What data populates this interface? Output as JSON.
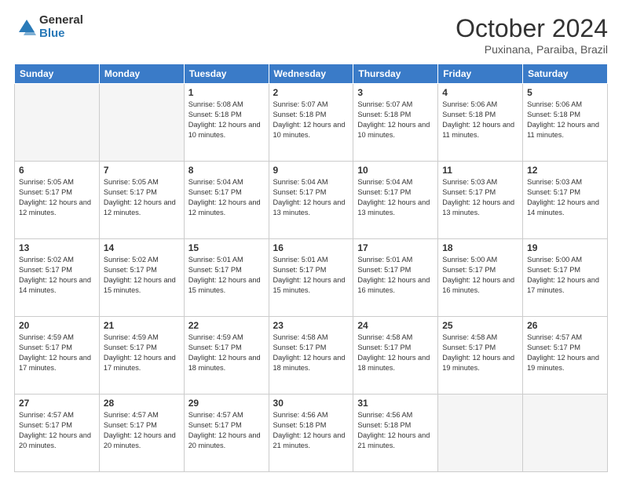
{
  "header": {
    "logo_general": "General",
    "logo_blue": "Blue",
    "month_title": "October 2024",
    "subtitle": "Puxinana, Paraiba, Brazil"
  },
  "weekdays": [
    "Sunday",
    "Monday",
    "Tuesday",
    "Wednesday",
    "Thursday",
    "Friday",
    "Saturday"
  ],
  "weeks": [
    [
      {
        "day": "",
        "info": ""
      },
      {
        "day": "",
        "info": ""
      },
      {
        "day": "1",
        "info": "Sunrise: 5:08 AM\nSunset: 5:18 PM\nDaylight: 12 hours and 10 minutes."
      },
      {
        "day": "2",
        "info": "Sunrise: 5:07 AM\nSunset: 5:18 PM\nDaylight: 12 hours and 10 minutes."
      },
      {
        "day": "3",
        "info": "Sunrise: 5:07 AM\nSunset: 5:18 PM\nDaylight: 12 hours and 10 minutes."
      },
      {
        "day": "4",
        "info": "Sunrise: 5:06 AM\nSunset: 5:18 PM\nDaylight: 12 hours and 11 minutes."
      },
      {
        "day": "5",
        "info": "Sunrise: 5:06 AM\nSunset: 5:18 PM\nDaylight: 12 hours and 11 minutes."
      }
    ],
    [
      {
        "day": "6",
        "info": "Sunrise: 5:05 AM\nSunset: 5:17 PM\nDaylight: 12 hours and 12 minutes."
      },
      {
        "day": "7",
        "info": "Sunrise: 5:05 AM\nSunset: 5:17 PM\nDaylight: 12 hours and 12 minutes."
      },
      {
        "day": "8",
        "info": "Sunrise: 5:04 AM\nSunset: 5:17 PM\nDaylight: 12 hours and 12 minutes."
      },
      {
        "day": "9",
        "info": "Sunrise: 5:04 AM\nSunset: 5:17 PM\nDaylight: 12 hours and 13 minutes."
      },
      {
        "day": "10",
        "info": "Sunrise: 5:04 AM\nSunset: 5:17 PM\nDaylight: 12 hours and 13 minutes."
      },
      {
        "day": "11",
        "info": "Sunrise: 5:03 AM\nSunset: 5:17 PM\nDaylight: 12 hours and 13 minutes."
      },
      {
        "day": "12",
        "info": "Sunrise: 5:03 AM\nSunset: 5:17 PM\nDaylight: 12 hours and 14 minutes."
      }
    ],
    [
      {
        "day": "13",
        "info": "Sunrise: 5:02 AM\nSunset: 5:17 PM\nDaylight: 12 hours and 14 minutes."
      },
      {
        "day": "14",
        "info": "Sunrise: 5:02 AM\nSunset: 5:17 PM\nDaylight: 12 hours and 15 minutes."
      },
      {
        "day": "15",
        "info": "Sunrise: 5:01 AM\nSunset: 5:17 PM\nDaylight: 12 hours and 15 minutes."
      },
      {
        "day": "16",
        "info": "Sunrise: 5:01 AM\nSunset: 5:17 PM\nDaylight: 12 hours and 15 minutes."
      },
      {
        "day": "17",
        "info": "Sunrise: 5:01 AM\nSunset: 5:17 PM\nDaylight: 12 hours and 16 minutes."
      },
      {
        "day": "18",
        "info": "Sunrise: 5:00 AM\nSunset: 5:17 PM\nDaylight: 12 hours and 16 minutes."
      },
      {
        "day": "19",
        "info": "Sunrise: 5:00 AM\nSunset: 5:17 PM\nDaylight: 12 hours and 17 minutes."
      }
    ],
    [
      {
        "day": "20",
        "info": "Sunrise: 4:59 AM\nSunset: 5:17 PM\nDaylight: 12 hours and 17 minutes."
      },
      {
        "day": "21",
        "info": "Sunrise: 4:59 AM\nSunset: 5:17 PM\nDaylight: 12 hours and 17 minutes."
      },
      {
        "day": "22",
        "info": "Sunrise: 4:59 AM\nSunset: 5:17 PM\nDaylight: 12 hours and 18 minutes."
      },
      {
        "day": "23",
        "info": "Sunrise: 4:58 AM\nSunset: 5:17 PM\nDaylight: 12 hours and 18 minutes."
      },
      {
        "day": "24",
        "info": "Sunrise: 4:58 AM\nSunset: 5:17 PM\nDaylight: 12 hours and 18 minutes."
      },
      {
        "day": "25",
        "info": "Sunrise: 4:58 AM\nSunset: 5:17 PM\nDaylight: 12 hours and 19 minutes."
      },
      {
        "day": "26",
        "info": "Sunrise: 4:57 AM\nSunset: 5:17 PM\nDaylight: 12 hours and 19 minutes."
      }
    ],
    [
      {
        "day": "27",
        "info": "Sunrise: 4:57 AM\nSunset: 5:17 PM\nDaylight: 12 hours and 20 minutes."
      },
      {
        "day": "28",
        "info": "Sunrise: 4:57 AM\nSunset: 5:17 PM\nDaylight: 12 hours and 20 minutes."
      },
      {
        "day": "29",
        "info": "Sunrise: 4:57 AM\nSunset: 5:17 PM\nDaylight: 12 hours and 20 minutes."
      },
      {
        "day": "30",
        "info": "Sunrise: 4:56 AM\nSunset: 5:18 PM\nDaylight: 12 hours and 21 minutes."
      },
      {
        "day": "31",
        "info": "Sunrise: 4:56 AM\nSunset: 5:18 PM\nDaylight: 12 hours and 21 minutes."
      },
      {
        "day": "",
        "info": ""
      },
      {
        "day": "",
        "info": ""
      }
    ]
  ]
}
